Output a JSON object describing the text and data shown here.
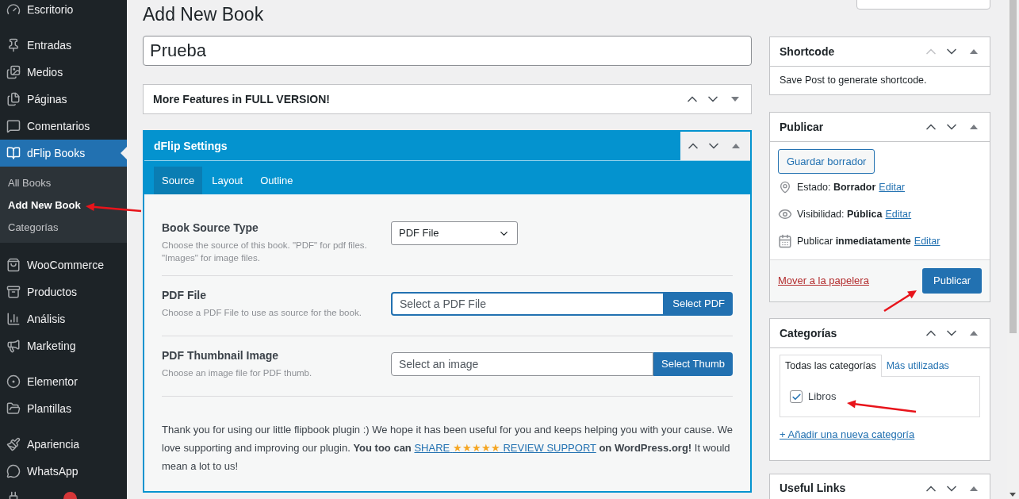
{
  "sidebar": {
    "groups": [
      {
        "items": [
          {
            "label": "Escritorio",
            "selected": false
          }
        ]
      },
      {
        "items": [
          {
            "label": "Entradas",
            "selected": false
          },
          {
            "label": "Medios",
            "selected": false
          },
          {
            "label": "Páginas",
            "selected": false
          },
          {
            "label": "Comentarios",
            "selected": false
          },
          {
            "label": "dFlip Books",
            "selected": true,
            "children": [
              {
                "label": "All Books",
                "selected": false
              },
              {
                "label": "Add New Book",
                "selected": true
              },
              {
                "label": "Categorías",
                "selected": false
              }
            ]
          }
        ]
      },
      {
        "items": [
          {
            "label": "WooCommerce",
            "selected": false
          },
          {
            "label": "Productos",
            "selected": false
          },
          {
            "label": "Análisis",
            "selected": false
          },
          {
            "label": "Marketing",
            "selected": false
          }
        ]
      },
      {
        "items": [
          {
            "label": "Elementor",
            "selected": false
          },
          {
            "label": "Plantillas",
            "selected": false
          }
        ]
      },
      {
        "items": [
          {
            "label": "Apariencia",
            "selected": false
          },
          {
            "label": "WhatsApp",
            "selected": false
          },
          {
            "selected": false,
            "has_badge": true
          }
        ]
      }
    ]
  },
  "page_title": "Add New Book",
  "title_field": {
    "value": "Prueba"
  },
  "features_box": {
    "title": "More Features in FULL VERSION!",
    "expanded": false,
    "up_disabled": false
  },
  "settings_box": {
    "title": "dFlip Settings",
    "expanded": true,
    "up_disabled": false,
    "tabs": [
      {
        "label": "Source",
        "selected": true
      },
      {
        "label": "Layout",
        "selected": false
      },
      {
        "label": "Outline",
        "selected": false
      }
    ],
    "fields": [
      {
        "kind": "select",
        "label": "Book Source Type",
        "description": "Choose the source of this book. \"PDF\" for pdf files. \"Images\" for image files.",
        "value": "PDF File"
      },
      {
        "kind": "file",
        "label": "PDF File",
        "description": "Choose a PDF File to use as source for the book.",
        "placeholder": "Select a PDF File",
        "button": "Select PDF",
        "focused": true
      },
      {
        "kind": "file",
        "label": "PDF Thumbnail Image",
        "description": "Choose an image file for PDF thumb.",
        "placeholder": "Select an image",
        "button": "Select Thumb",
        "focused": false
      }
    ],
    "note": {
      "before": "Thank you for using our little flipbook plugin :) We hope it has been useful for you and keeps helping you with your cause. We love supporting and improving our plugin. **You too can**",
      "link_start": "SHARE",
      "link_stars": "★★★★★",
      "link_end": "REVIEW SUPPORT",
      "after": "**on WordPress.org!** It would mean a lot to us!"
    }
  },
  "shortcode_box": {
    "title": "Shortcode",
    "up_disabled": true,
    "expanded": true,
    "text": "Save Post to generate shortcode."
  },
  "publish_box": {
    "title": "Publicar",
    "up_disabled": false,
    "expanded": true,
    "save_draft": "Guardar borrador",
    "rows": [
      {
        "kind": "status",
        "text": "Estado: **Borrador**",
        "link": "Editar"
      },
      {
        "kind": "visibility",
        "text": "Visibilidad: **Pública**",
        "link": "Editar"
      },
      {
        "kind": "schedule",
        "text": "Publicar **inmediatamente**",
        "link": "Editar"
      }
    ],
    "trash": "Mover a la papelera",
    "publish": "Publicar"
  },
  "categories_box": {
    "title": "Categorías",
    "up_disabled": false,
    "expanded": true,
    "tabs": [
      {
        "label": "Todas las categorías",
        "selected": true
      },
      {
        "label": "Más utilizadas",
        "selected": false
      }
    ],
    "items": [
      {
        "label": "Libros",
        "checked": true
      }
    ],
    "add_link": "+ Añadir una nueva categoría"
  },
  "links_box": {
    "title": "Useful Links",
    "up_disabled": false,
    "expanded": true
  }
}
